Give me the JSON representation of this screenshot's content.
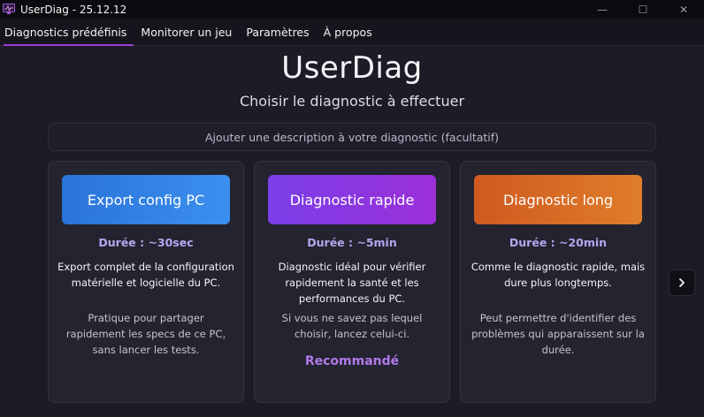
{
  "window": {
    "title": "UserDiag - 25.12.12",
    "controls": {
      "minimize": "—",
      "maximize": "☐",
      "close": "✕"
    }
  },
  "menu": {
    "items": [
      {
        "label": "Diagnostics prédéfinis",
        "active": true
      },
      {
        "label": "Monitorer un jeu",
        "active": false
      },
      {
        "label": "Paramètres",
        "active": false
      },
      {
        "label": "À propos",
        "active": false
      }
    ],
    "active_color": "#9c3cd6"
  },
  "main": {
    "title": "UserDiag",
    "subtitle": "Choisir le diagnostic à effectuer",
    "description_input": {
      "placeholder": "Ajouter une description à votre diagnostic (facultatif)",
      "value": ""
    },
    "cards": [
      {
        "button_label": "Export config PC",
        "button_color": "#3286e4",
        "duration": "Durée : ~30sec",
        "description": "Export complet de la configuration matérielle et logicielle du PC.",
        "note": "Pratique pour partager rapidement les specs de ce PC, sans lancer les tests.",
        "badge": ""
      },
      {
        "button_label": "Diagnostic rapide",
        "button_color": "#8a35e0",
        "duration": "Durée : ~5min",
        "description": "Diagnostic idéal pour vérifier rapidement la santé et les performances du PC.",
        "note": "Si vous ne savez pas lequel choisir, lancez celui-ci.",
        "badge": "Recommandé"
      },
      {
        "button_label": "Diagnostic long",
        "button_color": "#d76c25",
        "duration": "Durée : ~20min",
        "description": "Comme le diagnostic rapide, mais dure plus longtemps.",
        "note": "Peut permettre d'identifier des problèmes qui apparaissent sur la durée.",
        "badge": ""
      }
    ],
    "next_button_icon": "chevron-right-icon"
  }
}
